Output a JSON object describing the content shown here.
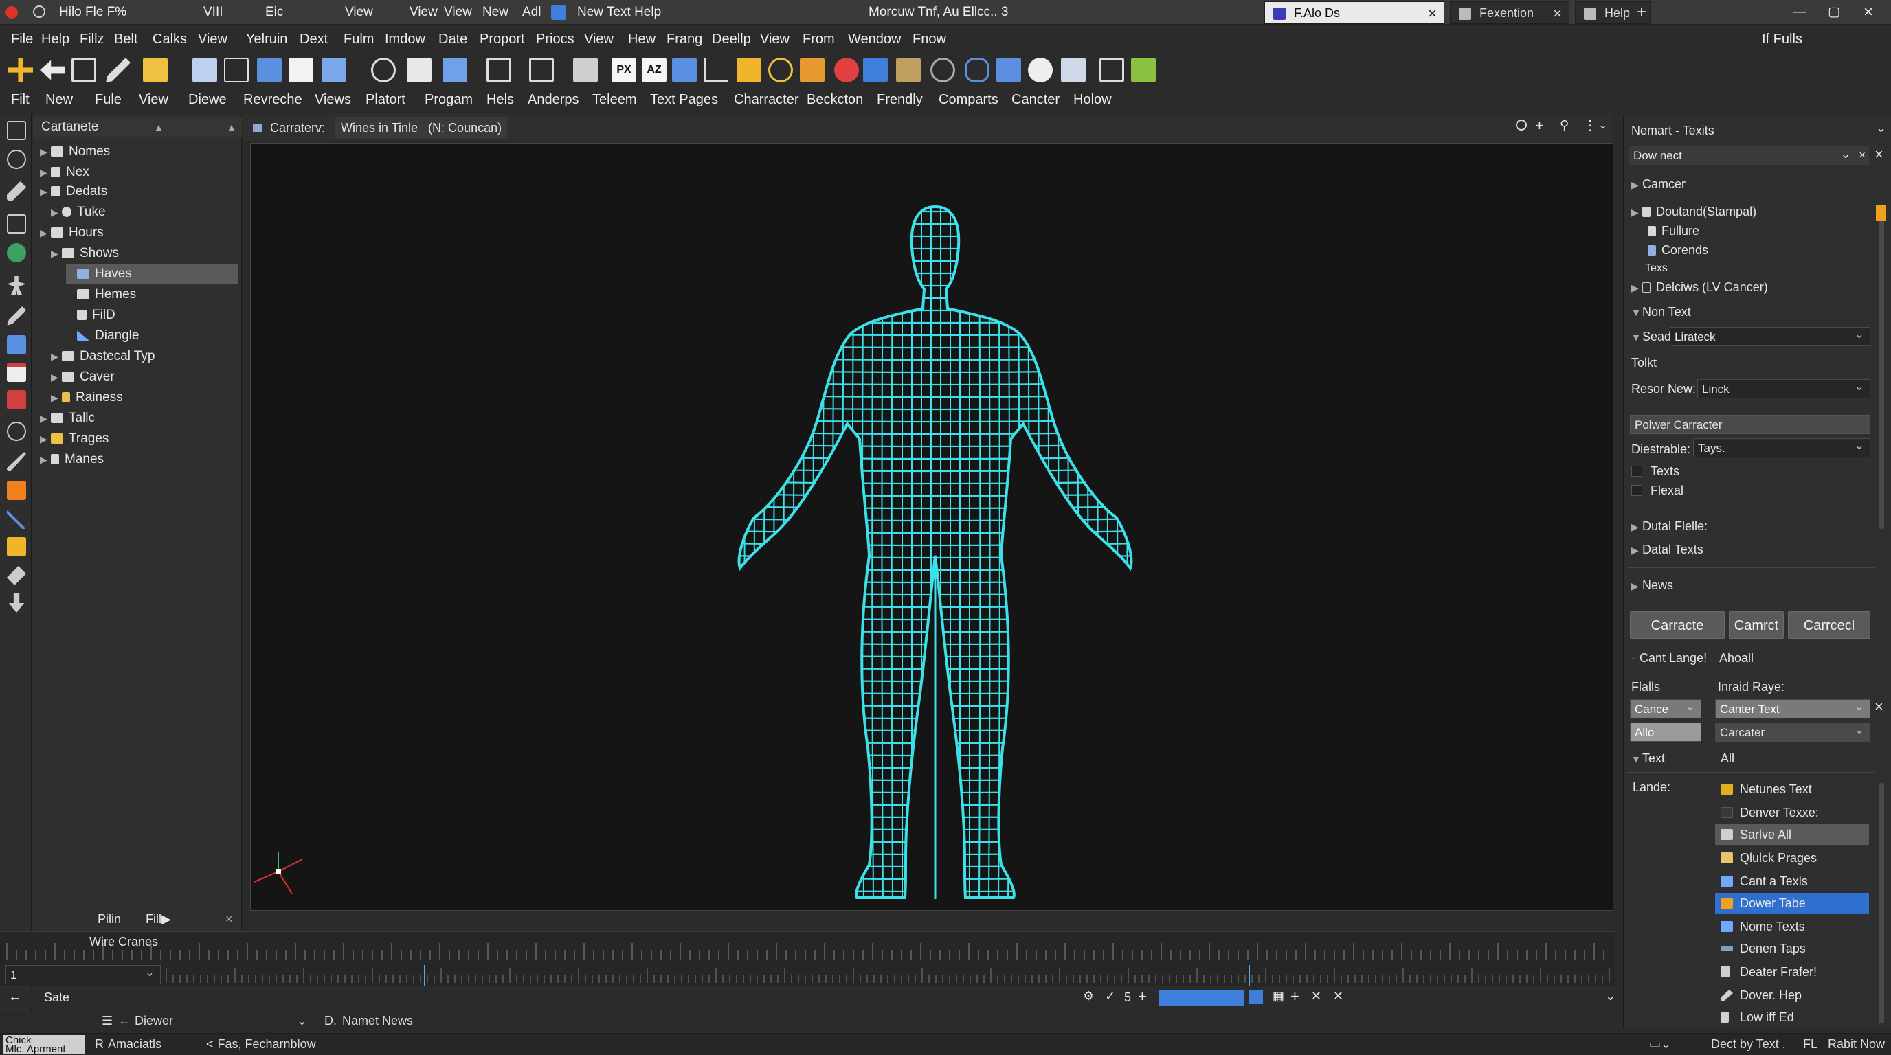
{
  "titlebar": {
    "items": [
      "Hilo Fle F%",
      "VIII",
      "Eic",
      "View",
      "View",
      "View",
      "New",
      "Adl",
      "New Text Help"
    ],
    "center": "Morcuw Tnf, Au Ellcc.. 3",
    "tabs": [
      "F.Alo Ds",
      "Fexention",
      "Help"
    ]
  },
  "menu": {
    "items": [
      "File",
      "Help",
      "Fillz",
      "Belt",
      "Calks",
      "View",
      "Yelruin",
      "Dext",
      "Fulm",
      "Imdow",
      "Date",
      "Proport",
      "Priocs",
      "View",
      "Hew",
      "Frang",
      "Deellp",
      "View",
      "From",
      "Wendow",
      "Fnow"
    ],
    "right": "If Fulls"
  },
  "toolbar": {
    "px_label": "PX",
    "az_label": "AZ"
  },
  "menu2": {
    "items": [
      "Filt",
      "New",
      "Fule",
      "View",
      "Diewe",
      "Revreche",
      "Views",
      "Platort",
      "Progam",
      "Hels",
      "Anderps",
      "Teleem",
      "Text Pages",
      "Charracter",
      "Beckcton",
      "Frendly",
      "Comparts",
      "Cancter",
      "Holow"
    ]
  },
  "outliner": {
    "title": "Cartanete",
    "rows": [
      {
        "label": "Nomes"
      },
      {
        "label": "Nex"
      },
      {
        "label": "Dedats"
      },
      {
        "label": "Tuke"
      },
      {
        "label": "Hours"
      },
      {
        "label": "Shows"
      },
      {
        "label": "Haves"
      },
      {
        "label": "Hemes"
      },
      {
        "label": "FilD"
      },
      {
        "label": "Diangle"
      },
      {
        "label": "Dastecal Typ"
      },
      {
        "label": "Caver"
      },
      {
        "label": "Rainess"
      },
      {
        "label": "Tallc"
      },
      {
        "label": "Trages"
      },
      {
        "label": "Manes"
      }
    ],
    "footer": [
      "Pilin",
      "Fill▶"
    ]
  },
  "viewport": {
    "tab_prefix": "Carraterv:",
    "tab_label": "Wines in Tinle",
    "tab_sub": "(N: Councan)"
  },
  "right": {
    "header": "Nemart - Texits",
    "search": "Dow nect",
    "section1": "Camcer",
    "tree": [
      "Doutand(Stampal)",
      "Fullure",
      "Corends",
      "Texs",
      "Delciws (LV Cancer)"
    ],
    "nontext": "Non Text",
    "seads_label": "Seads",
    "seads_value": "Lirateck",
    "tolkt": "Tolkt",
    "resor_label": "Resor New:",
    "resor_value": "Linck",
    "polwer": "Polwer Carracter",
    "diestrable_label": "Diestrable:",
    "diestrable_value": "Tays.",
    "check1": "Texts",
    "check2": "Flexal",
    "dutal": "Dutal Flelle:",
    "datal": "Datal Texts",
    "news": "News",
    "buttons": [
      "Carracte",
      "Camrct",
      "Carrcecl"
    ],
    "cant": "Cant Lange!",
    "ahoall": "Ahoall",
    "falls": "Flalls",
    "inraid": "Inraid Raye:",
    "cance": "Cance",
    "canter": "Canter Text",
    "allo": "Allo",
    "carcater": "Carcater",
    "text": "Text",
    "all": "All",
    "lande": "Lande:",
    "list": [
      {
        "label": "Netunes Text",
        "color": "#e0b020"
      },
      {
        "label": "Denver Texxe:",
        "color": "#3a3a3a"
      },
      {
        "label": "Sarlve All",
        "color": "#cfcfcf"
      },
      {
        "label": "Qlulck Prages",
        "color": "#e8c46a"
      },
      {
        "label": "Cant a Texls",
        "color": "#6fa8ff"
      },
      {
        "label": "Dower Tabe",
        "color": "#f0a020"
      },
      {
        "label": "Nome Texts",
        "color": "#6fa8ff"
      },
      {
        "label": "Denen Taps",
        "color": "#7aa0c8"
      },
      {
        "label": "Deater Frafer!",
        "color": "#cfcfcf"
      },
      {
        "label": "Dover. Hep",
        "color": "#d0d0d0"
      },
      {
        "label": "Low iff Ed",
        "color": "#d0d0d0"
      }
    ]
  },
  "timeline": {
    "title": "Wire Cranes",
    "frame": "1",
    "state": "Sate",
    "frame_count": "5"
  },
  "bottom": {
    "layer": "Diewer",
    "namet": "Namet News",
    "chick1": "Chick",
    "chick2": "Mlc. Aprment",
    "amaciatls": "Amaciatls",
    "fas": "Fas, Fecharnblow",
    "dect": "Dect by Text .",
    "fl": "FL",
    "rabit": "Rabit Now"
  },
  "colors": {
    "wireframe": "#3ee0e8",
    "selection": "#2f6fcf",
    "viewport_bg": "#151515"
  }
}
